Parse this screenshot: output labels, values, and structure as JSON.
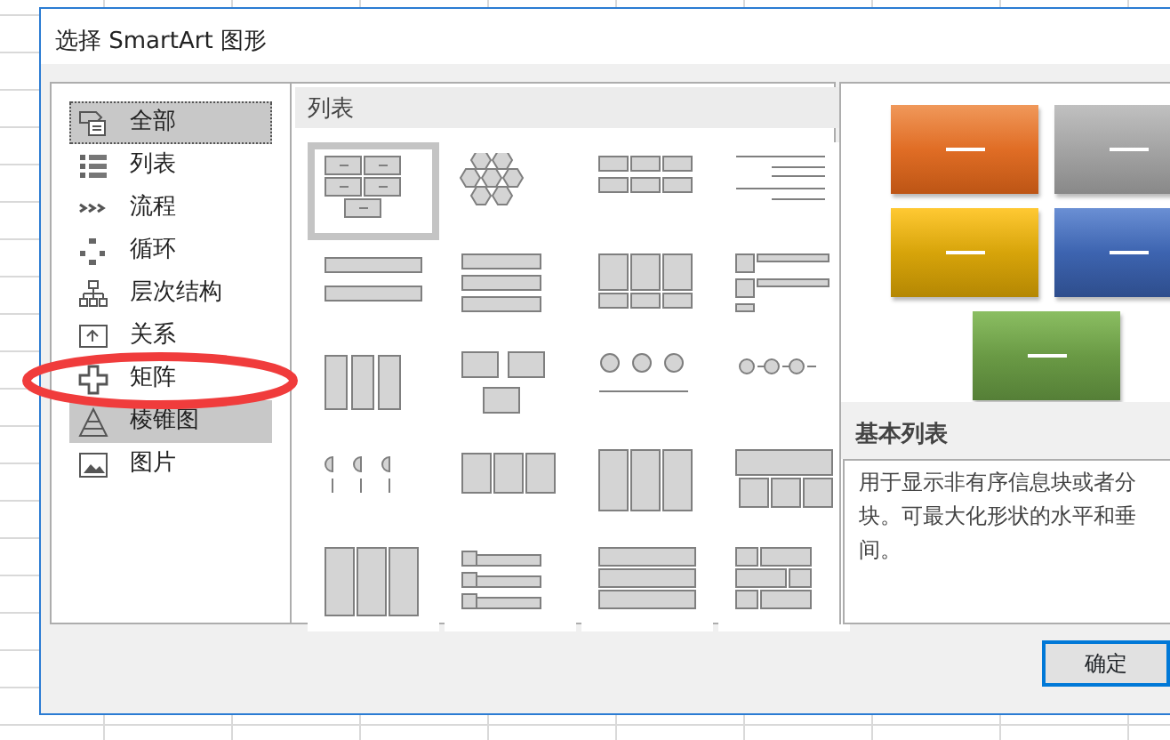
{
  "window": {
    "title": "选择 SmartArt 图形"
  },
  "categories": [
    {
      "label": "全部",
      "selected": true,
      "hovered": false
    },
    {
      "label": "列表",
      "selected": false,
      "hovered": false
    },
    {
      "label": "流程",
      "selected": false,
      "hovered": false
    },
    {
      "label": "循环",
      "selected": false,
      "hovered": false
    },
    {
      "label": "层次结构",
      "selected": false,
      "hovered": false
    },
    {
      "label": "关系",
      "selected": false,
      "hovered": false
    },
    {
      "label": "矩阵",
      "selected": false,
      "hovered": false
    },
    {
      "label": "棱锥图",
      "selected": false,
      "hovered": true
    },
    {
      "label": "图片",
      "selected": false,
      "hovered": false
    }
  ],
  "gallery": {
    "title": "列表",
    "items": [
      {
        "selected": true
      },
      {
        "selected": false
      },
      {
        "selected": false
      },
      {
        "selected": false
      },
      {
        "selected": false
      },
      {
        "selected": false
      },
      {
        "selected": false
      },
      {
        "selected": false
      },
      {
        "selected": false
      },
      {
        "selected": false
      },
      {
        "selected": false
      },
      {
        "selected": false
      },
      {
        "selected": false
      },
      {
        "selected": false
      },
      {
        "selected": false
      },
      {
        "selected": false
      },
      {
        "selected": false
      },
      {
        "selected": false
      },
      {
        "selected": false
      },
      {
        "selected": false
      }
    ]
  },
  "details": {
    "title": "基本列表",
    "description_lines": [
      "用于显示非有序信息块或者分",
      "块。可最大化形状的水平和垂",
      "间。"
    ]
  },
  "buttons": [
    "确定"
  ]
}
